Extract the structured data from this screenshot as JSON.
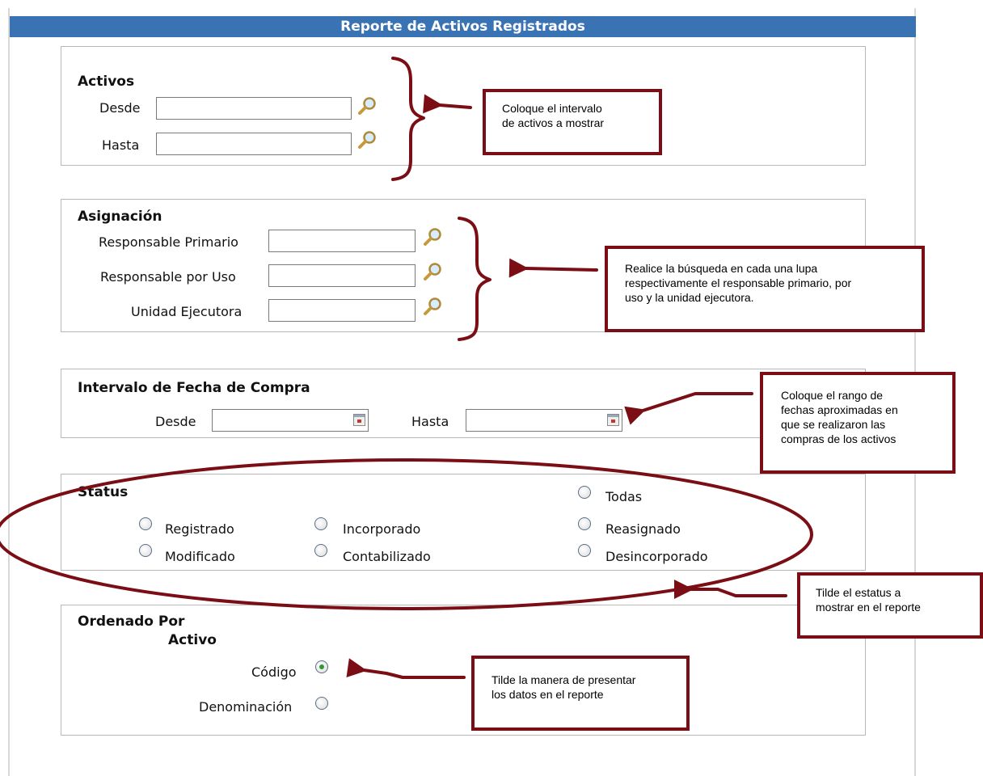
{
  "title": "Reporte de Activos Registrados",
  "activos": {
    "heading": "Activos",
    "desde_label": "Desde",
    "hasta_label": "Hasta",
    "desde_value": "",
    "hasta_value": ""
  },
  "asignacion": {
    "heading": "Asignación",
    "responsable_primario": "Responsable Primario",
    "responsable_uso": "Responsable por Uso",
    "unidad_ejecutora": "Unidad Ejecutora"
  },
  "fecha_compra": {
    "heading": "Intervalo de Fecha de Compra",
    "desde_label": "Desde",
    "hasta_label": "Hasta"
  },
  "status": {
    "heading": "Status",
    "options": {
      "registrado": "Registrado",
      "incorporado": "Incorporado",
      "todas": "Todas",
      "reasignado": "Reasignado",
      "modificado": "Modificado",
      "contabilizado": "Contabilizado",
      "desincorporado": "Desincorporado"
    }
  },
  "ordenado": {
    "heading": "Ordenado Por",
    "subheading": "Activo",
    "codigo": "Código",
    "denominacion": "Denominación",
    "selected": "Código"
  },
  "notes": {
    "activos": [
      "Coloque el intervalo",
      "de activos a mostrar"
    ],
    "asignacion": [
      "Realice la búsqueda en cada una lupa",
      "respectivamente el responsable primario, por",
      "uso y la unidad ejecutora."
    ],
    "fechas": [
      "Coloque el rango de",
      "fechas aproximadas en",
      "que se realizaron las",
      "compras de los activos"
    ],
    "status": [
      "Tilde el estatus a",
      "mostrar en el reporte"
    ],
    "orden": [
      "Tilde la manera de presentar",
      "los datos en el reporte"
    ]
  },
  "colors": {
    "header": "#3a73b4",
    "annotation": "#7a0e14"
  },
  "icons": {
    "search": "search-icon",
    "calendar": "calendar-icon"
  }
}
